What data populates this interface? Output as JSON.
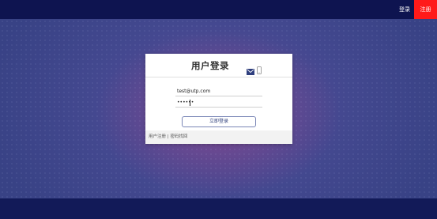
{
  "topbar": {
    "login_label": "登录",
    "register_label": "注册"
  },
  "colors": {
    "topbar_bg": "#0e1450",
    "register_bg": "#ff1a1a",
    "page_bg": "#3b3f86",
    "button_border": "#7a86b6"
  },
  "login_card": {
    "title": "用户登录",
    "icons": [
      "mail-icon",
      "phone-icon"
    ],
    "email_value": "test@utp.com",
    "password_value": "••••••",
    "submit_label": "立即登录",
    "footer_register": "用户注册",
    "footer_separator": " | ",
    "footer_forgot": "密码找回"
  }
}
